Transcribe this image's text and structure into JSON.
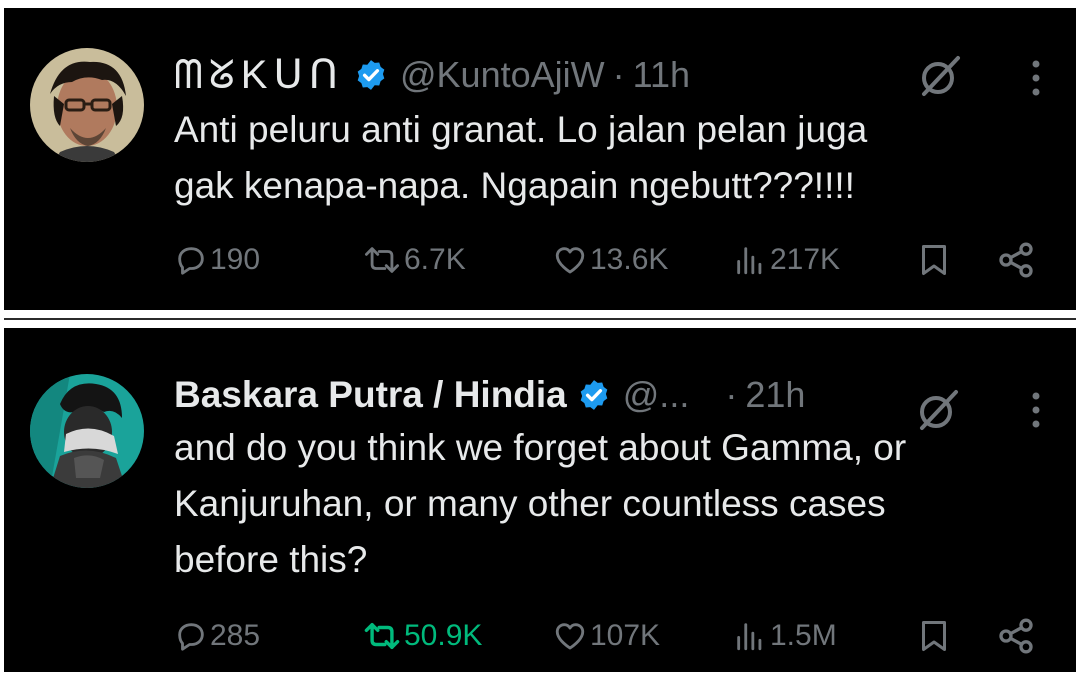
{
  "tweets": [
    {
      "display_name": "ᗰᘜKᑌᑎ",
      "verified": true,
      "handle": "@KuntoAjiW",
      "separator": "·",
      "time": "11h",
      "text": "Anti peluru anti granat. Lo jalan pelan juga\ngak kenapa-napa. Ngapain ngebutt???!!!!",
      "stats": {
        "replies": "190",
        "reposts": "6.7K",
        "likes": "13.6K",
        "views": "217K"
      },
      "reposted": false
    },
    {
      "display_name": "Baskara Putra / Hindia",
      "verified": true,
      "handle": "@...",
      "separator": "·",
      "time": "21h",
      "text": "and do you think we forget about Gamma, or\nKanjuruhan, or many other countless cases\nbefore this?",
      "stats": {
        "replies": "285",
        "reposts": "50.9K",
        "likes": "107K",
        "views": "1.5M"
      },
      "reposted": true
    }
  ],
  "colors": {
    "background": "#000000",
    "text_primary": "#e7e9ea",
    "text_secondary": "#71767b",
    "verified_blue": "#1d9bf0",
    "repost_active": "#00ba7c"
  },
  "icons": [
    "reply-icon",
    "repost-icon",
    "like-icon",
    "views-icon",
    "bookmark-icon",
    "share-icon",
    "grok-icon",
    "more-icon",
    "verified-badge-icon"
  ]
}
